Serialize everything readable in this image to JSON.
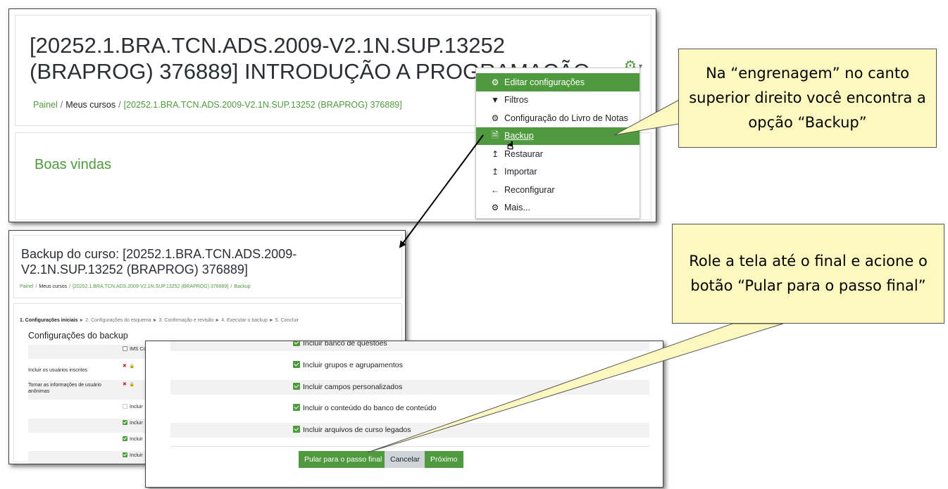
{
  "course_page": {
    "title": "[20252.1.BRA.TCN.ADS.2009-V2.1N.SUP.13252 (BRAPROG) 376889] INTRODUÇÃO A PROGRAMAÇÃO",
    "breadcrumb": [
      "Painel",
      "Meus cursos",
      "[20252.1.BRA.TCN.ADS.2009-V2.1N.SUP.13252 (BRAPROG) 376889]"
    ],
    "section_title": "Boas vindas",
    "settings_menu": [
      {
        "label": "Editar configurações",
        "icon": "gear-icon"
      },
      {
        "label": "Filtros",
        "icon": "filter-icon"
      },
      {
        "label": "Configuração do Livro de Notas",
        "icon": "gear-icon"
      },
      {
        "label": "Backup",
        "icon": "file-icon"
      },
      {
        "label": "Restaurar",
        "icon": "upload-icon"
      },
      {
        "label": "Importar",
        "icon": "upload-icon"
      },
      {
        "label": "Reconfigurar",
        "icon": "arrow-left-icon"
      },
      {
        "label": "Mais...",
        "icon": "gear-icon"
      }
    ]
  },
  "backup_page": {
    "title": "Backup do curso: [20252.1.BRA.TCN.ADS.2009-V2.1N.SUP.13252 (BRAPROG) 376889]",
    "breadcrumb": [
      "Painel",
      "Meus cursos",
      "[20252.1.BRA.TCN.ADS.2009-V2.1N.SUP.13252 (BRAPROG) 376889]",
      "Backup"
    ],
    "steps": {
      "current": "1. Configurações iniciais",
      "rest": [
        "2. Configurações do esquema",
        "3. Confirmação e revisão",
        "4. Executar o backup",
        "5. Concluir"
      ]
    },
    "settings_heading": "Configurações do backup",
    "rows": [
      {
        "label": "",
        "option": "IMS Co"
      },
      {
        "label": "Incluir os usuários inscritos",
        "option": ""
      },
      {
        "label": "Tornar as informações de usuário anônimas",
        "option": ""
      },
      {
        "label": "",
        "option": "Incluir"
      },
      {
        "label": "",
        "option": "Incluir"
      },
      {
        "label": "",
        "option": "Incluir"
      },
      {
        "label": "",
        "option": "Incluir"
      }
    ]
  },
  "backup_bottom": {
    "options": [
      "Incluir banco de questões",
      "Incluir grupos e agrupamentos",
      "Incluir campos personalizados",
      "Incluir o conteúdo do banco de conteúdo",
      "Incluir arquivos de curso legados"
    ],
    "buttons": {
      "skip": "Pular para o passo final",
      "cancel": "Cancelar",
      "next": "Próximo"
    }
  },
  "callouts": {
    "gear": "Na “engrenagem” no canto superior direito você encontra a opção “Backup”",
    "scroll": "Role a tela até o final e acione o botão “Pular para o passo final”"
  },
  "colors": {
    "accent": "#4f9a3e",
    "callout_bg": "#fdf8c0"
  }
}
